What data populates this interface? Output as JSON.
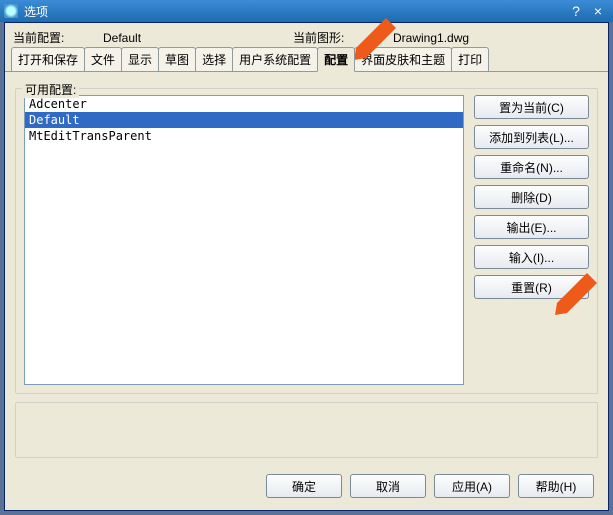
{
  "titlebar": {
    "title": "选项"
  },
  "info": {
    "current_profile_label": "当前配置:",
    "current_profile_value": "Default",
    "current_drawing_label": "当前图形:",
    "current_drawing_value": "Drawing1.dwg"
  },
  "tabs": [
    "打开和保存",
    "文件",
    "显示",
    "草图",
    "选择",
    "用户系统配置",
    "配置",
    "界面皮肤和主题",
    "打印"
  ],
  "active_tab_index": 6,
  "profiles": {
    "group_label": "可用配置:",
    "items": [
      "Adcenter",
      "Default",
      "MtEditTransParent"
    ],
    "selected_index": 1,
    "buttons": {
      "set_current": "置为当前(C)",
      "add_to_list": "添加到列表(L)...",
      "rename": "重命名(N)...",
      "delete": "删除(D)",
      "export": "输出(E)...",
      "import": "输入(I)...",
      "reset": "重置(R)"
    }
  },
  "bottom": {
    "ok": "确定",
    "cancel": "取消",
    "apply": "应用(A)",
    "help": "帮助(H)"
  }
}
